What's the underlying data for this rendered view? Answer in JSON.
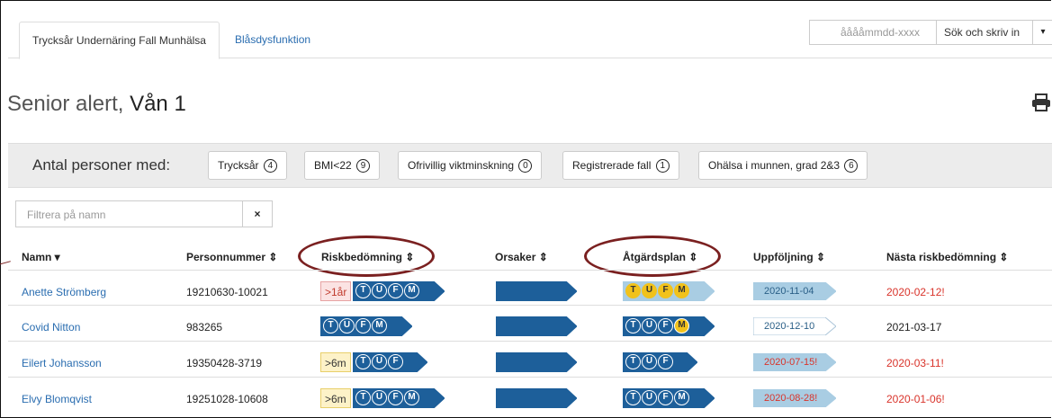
{
  "tabs": [
    {
      "label": "Trycksår Undernäring Fall Munhälsa"
    },
    {
      "label": "Blåsdysfunktion"
    }
  ],
  "search": {
    "placeholder": "ååååmmdd-xxxx",
    "button_label": "Sök och skriv in"
  },
  "page": {
    "title_prefix": "Senior alert,",
    "title_unit": "Vån 1"
  },
  "filters": {
    "label": "Antal personer med:",
    "chips": [
      {
        "label": "Trycksår",
        "count": "4"
      },
      {
        "label": "BMI<22",
        "count": "9"
      },
      {
        "label": "Ofrivillig viktminskning",
        "count": "0"
      },
      {
        "label": "Registrerade fall",
        "count": "1"
      },
      {
        "label": "Ohälsa i munnen, grad 2&3",
        "count": "6"
      }
    ]
  },
  "name_filter": {
    "placeholder": "Filtrera på namn",
    "clear_icon": "×"
  },
  "table": {
    "headers": [
      "Namn ▾",
      "Personnummer ⇕",
      "Riskbedömning ⇕",
      "Orsaker ⇕",
      "Åtgärdsplan ⇕",
      "Uppföljning ⇕",
      "Nästa riskbedömning ⇕"
    ],
    "rows": [
      {
        "name": "Anette Strömberg",
        "pnr": "19210630-10021",
        "risk_age": ">1år",
        "risk_age_style": "red",
        "risk_letters": [
          "T",
          "U",
          "F",
          "M"
        ],
        "plan": [
          [
            "T",
            "y"
          ],
          [
            "U",
            "y"
          ],
          [
            "F",
            "y"
          ],
          [
            "M",
            "y"
          ]
        ],
        "plan_style": "light",
        "followup": "2020-11-04",
        "followup_style": "blue",
        "next": "2020-02-12!",
        "next_red": true
      },
      {
        "name": "Covid Nitton",
        "pnr": "983265",
        "risk_age": "",
        "risk_age_style": "",
        "risk_letters": [
          "T",
          "U",
          "F",
          "M"
        ],
        "plan": [
          [
            "T",
            "w"
          ],
          [
            "U",
            "w"
          ],
          [
            "F",
            "w"
          ],
          [
            "M",
            "ym"
          ]
        ],
        "plan_style": "dark",
        "followup": "2020-12-10",
        "followup_style": "white",
        "next": "2021-03-17",
        "next_red": false
      },
      {
        "name": "Eilert Johansson",
        "pnr": "19350428-3719",
        "risk_age": ">6m",
        "risk_age_style": "yellow",
        "risk_letters": [
          "T",
          "U",
          "F"
        ],
        "plan": [
          [
            "T",
            "w"
          ],
          [
            "U",
            "w"
          ],
          [
            "F",
            "w"
          ]
        ],
        "plan_style": "dark",
        "followup": "2020-07-15!",
        "followup_style": "bluered",
        "next": "2020-03-11!",
        "next_red": true
      },
      {
        "name": "Elvy Blomqvist",
        "pnr": "19251028-10608",
        "risk_age": ">6m",
        "risk_age_style": "yellow",
        "risk_letters": [
          "T",
          "U",
          "F",
          "M"
        ],
        "plan": [
          [
            "T",
            "w"
          ],
          [
            "U",
            "w"
          ],
          [
            "F",
            "w"
          ],
          [
            "M",
            "w"
          ]
        ],
        "plan_style": "dark",
        "followup": "2020-08-28!",
        "followup_style": "bluered",
        "next": "2020-01-06!",
        "next_red": true
      }
    ]
  },
  "colors": {
    "link": "#2a6db0",
    "accent_dark": "#1d5f9a",
    "alert": "#d9342b",
    "highlight_ring": "#7a2020",
    "yellow": "#f1c21b",
    "light_blue": "#a9cde3"
  }
}
